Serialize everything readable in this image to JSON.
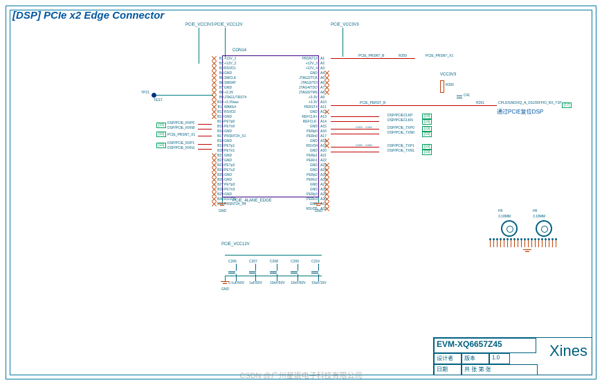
{
  "title": "[DSP] PCIe x2 Edge Connector",
  "annotation_cn": "通过PCIE复位DSP",
  "ic": {
    "refdes": "CON14",
    "type": "PCIE_4LANE_EDGE",
    "left_pins": [
      "+12V_1",
      "+12V_2",
      "RSVD1",
      "GND",
      "SMCLK",
      "SMDAT",
      "GND",
      "+3.3V",
      "JTAG1/TRST#",
      "+3.3Vaux",
      "WAKE#",
      "RSVD2",
      "GND",
      "PETp0",
      "PETn0",
      "GND",
      "PRSNT2#_X1",
      "GND",
      "PETp1",
      "PETn1",
      "GND",
      "GND",
      "PETp2",
      "PETn2",
      "GND",
      "GND",
      "PETp3",
      "PETn3",
      "GND",
      "RSVD3",
      "PRSNT2#_X4"
    ],
    "left_nums": [
      "B1",
      "B2",
      "B3",
      "B4",
      "B5",
      "B6",
      "B7",
      "B8",
      "B9",
      "B10",
      "B11",
      "B12",
      "B13",
      "B14",
      "B15",
      "B16",
      "B17",
      "B18",
      "B19",
      "B20",
      "B21",
      "B22",
      "B23",
      "B24",
      "B25",
      "B26",
      "B27",
      "B28",
      "B29",
      "B30",
      "B31"
    ],
    "right_pins": [
      "PRSNT1#",
      "+12V_3",
      "+12V_4",
      "GND",
      "JTAG2/TCK",
      "JTAG3/TDI",
      "JTAG4/TDO",
      "JTAG5/TMS",
      "+3.3V",
      "+3.3V",
      "PERST#",
      "GND",
      "REFCLK+",
      "REFCLK-",
      "GND",
      "PERp0",
      "PERn0",
      "GND",
      "RSVD4",
      "GND",
      "PERp1",
      "PERn1",
      "GND",
      "GND",
      "PERp2",
      "PERn2",
      "GND",
      "GND",
      "PERp3",
      "PERn3",
      "GND",
      "RSVD5"
    ],
    "right_nums": [
      "A1",
      "A2",
      "A3",
      "A4",
      "A5",
      "A6",
      "A7",
      "A8",
      "A9",
      "A10",
      "A11",
      "A12",
      "A13",
      "A14",
      "A15",
      "A16",
      "A17",
      "A18",
      "A19",
      "A20",
      "A21",
      "A22",
      "A23",
      "A24",
      "A25",
      "A26",
      "A27",
      "A28",
      "A29",
      "A30",
      "A31",
      "A32"
    ]
  },
  "rails": {
    "vcc3v3_l": "PCIE_VCC3V3",
    "vcc12v": "PCIE_VCC12V",
    "vcc3v3_r": "PCIE_VCC3V3",
    "vcc3v3_far": "VCC3V3",
    "cap12v": "PCIE_VCC12V"
  },
  "testpoint": {
    "ref": "TP21",
    "label": "TEST"
  },
  "nets": {
    "prsnt_b": "PCIE_PRSNT_B",
    "prsnt_x1_out": "PCIE_PRSNT_X1",
    "perst": "PCIE_PERST_B",
    "perst_out": "CPLD/GND/XQ_A_D11/DIFFIO_RX_T1P",
    "prsnt_x1": "PCIE_PRSNT_X1",
    "refclkp": "DSP/PCIECLKP",
    "refclkn": "DSP/PCIECLKN",
    "rxp0": "DSP/PCIE_RXP0",
    "rxn0": "DSP/PCIE_RXN0",
    "txp0": "DSP/PCIE_TXP0",
    "txn0": "DSP/PCIE_TXN0",
    "rxp1": "DSP/PCIE_RXP1",
    "rxn1": "DSP/PCIE_RXN1",
    "txp1": "DSP/PCIE_TXP1",
    "txn1": "DSP/PCIE_TXN1"
  },
  "offpage": {
    "p15": "[15]",
    "p16": "[16]",
    "p19": "[19]",
    "p17": "[17]"
  },
  "passives": {
    "r259": "R259",
    "r260": "R260",
    "r261": "R261",
    "c203": "C203",
    "c204": "C204",
    "c205": "C205",
    "c206": "C206",
    "c41": "C41",
    "cval": "0.1uF",
    "caps": [
      {
        "ref": "C206",
        "val": "0.1uF/50V"
      },
      {
        "ref": "C207",
        "val": "1uF/50V"
      },
      {
        "ref": "C208",
        "val": "10nF/50V"
      },
      {
        "ref": "C209",
        "val": "10nF/50V"
      },
      {
        "ref": "C210",
        "val": "10uF/16V"
      }
    ]
  },
  "holes": {
    "h5": {
      "ref": "H5",
      "val": "3.18MM"
    },
    "h6": {
      "ref": "H6",
      "val": "3.18MM"
    }
  },
  "titleblock": {
    "model": "EVM-XQ6657Z45",
    "company": "Xines",
    "designer_lbl": "设计者",
    "rev_lbl": "版本",
    "rev": "1.0",
    "date_lbl": "日期",
    "sheet_lbl": "共 张 第 张"
  },
  "watermark": "CSDN @广州星嵌电子科技有限公司"
}
